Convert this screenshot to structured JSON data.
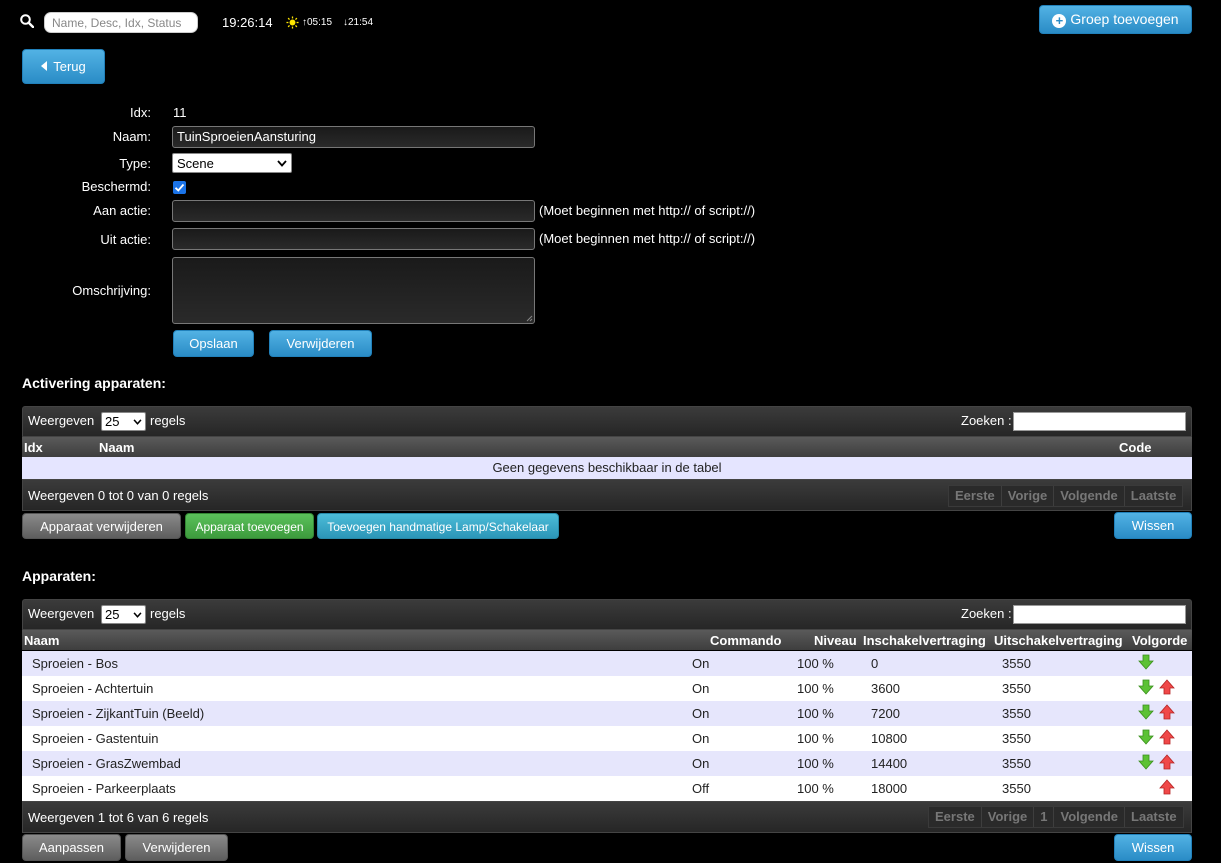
{
  "topbar": {
    "search_placeholder": "Name, Desc, Idx, Status",
    "time": "19:26:14",
    "sunrise": "05:15",
    "sunset": "21:54",
    "add_group_label": "Groep toevoegen"
  },
  "back_label": "Terug",
  "form": {
    "idx_label": "Idx:",
    "idx_value": "11",
    "name_label": "Naam:",
    "name_value": "TuinSproeienAansturing",
    "type_label": "Type:",
    "type_value": "Scene",
    "protected_label": "Beschermd:",
    "protected_checked": true,
    "on_action_label": "Aan actie:",
    "on_action_value": "",
    "off_action_label": "Uit actie:",
    "off_action_value": "",
    "action_hint": "(Moet beginnen met http:// of script://)",
    "description_label": "Omschrijving:",
    "description_value": "",
    "save_label": "Opslaan",
    "delete_label": "Verwijderen"
  },
  "activation": {
    "title": "Activering apparaten:",
    "show_label": "Weergeven",
    "page_size": "25",
    "rows_label": "regels",
    "search_label": "Zoeken :",
    "columns": [
      "Idx",
      "Naam",
      "Code"
    ],
    "empty_text": "Geen gegevens beschikbaar in de tabel",
    "info": "Weergeven 0 tot 0 van 0 regels",
    "pager": [
      "Eerste",
      "Vorige",
      "Volgende",
      "Laatste"
    ],
    "btn_remove_device": "Apparaat verwijderen",
    "btn_add_device": "Apparaat toevoegen",
    "btn_add_manual": "Toevoegen handmatige Lamp/Schakelaar",
    "btn_clear": "Wissen"
  },
  "devices": {
    "title": "Apparaten:",
    "show_label": "Weergeven",
    "page_size": "25",
    "rows_label": "regels",
    "search_label": "Zoeken :",
    "columns": [
      "Naam",
      "Commando",
      "Niveau",
      "Inschakelvertraging",
      "Uitschakelvertraging",
      "Volgorde"
    ],
    "rows": [
      {
        "name": "Sproeien - Bos",
        "command": "On",
        "level": "100 %",
        "on_delay": "0",
        "off_delay": "3550",
        "down": true,
        "up": false
      },
      {
        "name": "Sproeien - Achtertuin",
        "command": "On",
        "level": "100 %",
        "on_delay": "3600",
        "off_delay": "3550",
        "down": true,
        "up": true
      },
      {
        "name": "Sproeien - ZijkantTuin (Beeld)",
        "command": "On",
        "level": "100 %",
        "on_delay": "7200",
        "off_delay": "3550",
        "down": true,
        "up": true
      },
      {
        "name": "Sproeien - Gastentuin",
        "command": "On",
        "level": "100 %",
        "on_delay": "10800",
        "off_delay": "3550",
        "down": true,
        "up": true
      },
      {
        "name": "Sproeien - GrasZwembad",
        "command": "On",
        "level": "100 %",
        "on_delay": "14400",
        "off_delay": "3550",
        "down": true,
        "up": true
      },
      {
        "name": "Sproeien - Parkeerplaats",
        "command": "Off",
        "level": "100 %",
        "on_delay": "18000",
        "off_delay": "3550",
        "down": false,
        "up": true
      }
    ],
    "info": "Weergeven 1 tot 6 van 6 regels",
    "pager": [
      "Eerste",
      "Vorige",
      "1",
      "Volgende",
      "Laatste"
    ],
    "btn_edit": "Aanpassen",
    "btn_delete": "Verwijderen",
    "btn_clear": "Wissen"
  },
  "colors": {
    "accent_blue": "#2a8cc6",
    "arrow_down_green": "#5cc234",
    "arrow_up_red": "#f04848",
    "row_alt": "#e6e6fc"
  }
}
